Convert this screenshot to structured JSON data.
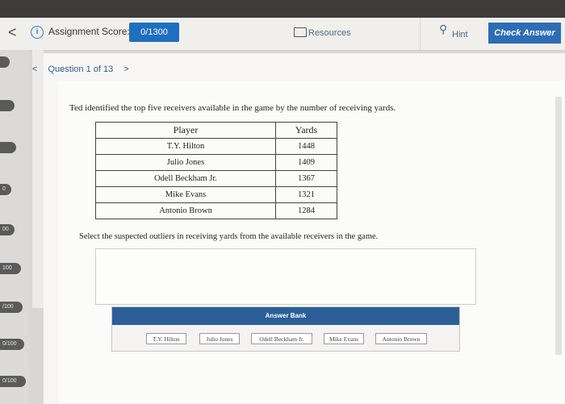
{
  "header": {
    "back_glyph": "<",
    "info_glyph": "i",
    "score_label": "Assignment Score:",
    "score_value": "0/1300",
    "resources_label": "Resources",
    "hint_label": "Hint",
    "check_label": "Check Answer"
  },
  "question_nav": {
    "prev_glyph": "<",
    "label": "Question 1 of 13",
    "next_glyph": ">"
  },
  "sidebar": {
    "items": [
      "",
      "",
      "",
      "0",
      "00",
      "100",
      "/100",
      "0/100",
      "0/100"
    ]
  },
  "question": {
    "prompt": "Ted identified the top five receivers available in the game by the number of receiving yards.",
    "table": {
      "headers": [
        "Player",
        "Yards"
      ],
      "rows": [
        [
          "T.Y. Hilton",
          "1448"
        ],
        [
          "Julio Jones",
          "1409"
        ],
        [
          "Odell Beckham Jr.",
          "1367"
        ],
        [
          "Mike Evans",
          "1321"
        ],
        [
          "Antonio Brown",
          "1284"
        ]
      ]
    },
    "select_prompt": "Select the suspected outliers in receiving yards from the available receivers in the game."
  },
  "answer_bank": {
    "title": "Answer Bank",
    "options": [
      "T.Y. Hilton",
      "Julio Jones",
      "Odell Beckham Jr.",
      "Mike Evans",
      "Antonio Brown"
    ]
  },
  "colors": {
    "accent": "#1f6fbf",
    "check_button": "#2d6db5",
    "bank_header": "#2c5f98"
  }
}
